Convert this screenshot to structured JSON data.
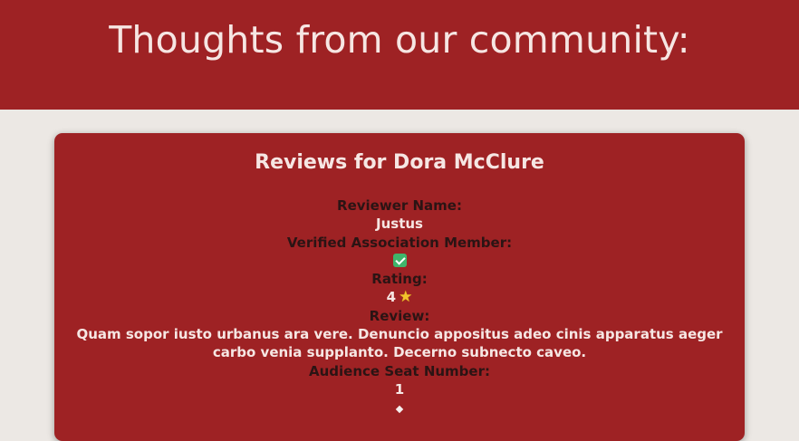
{
  "header": {
    "title": "Thoughts from our community:"
  },
  "review_card": {
    "title": "Reviews for Dora McClure",
    "reviewer_name_label": "Reviewer Name:",
    "reviewer_name": "Justus",
    "verified_label": "Verified Association Member:",
    "verified_icon": "check-mark-icon",
    "rating_label": "Rating:",
    "rating": "4",
    "rating_icon": "star-icon",
    "review_label": "Review:",
    "review_text": "Quam sopor iusto urbanus ara vere. Denuncio appositus adeo cinis apparatus aeger carbo venia supplanto. Decerno subnecto caveo.",
    "seat_label": "Audience Seat Number:",
    "seat_number": "1",
    "divider_icon": "diamond-icon"
  },
  "colors": {
    "brand_red": "#9e2224",
    "page_background": "#ece8e4",
    "heading_text": "#f6e6e3",
    "label_text": "#2b1414",
    "verified_green": "#3fb56b",
    "star_yellow": "#f2c22c"
  }
}
